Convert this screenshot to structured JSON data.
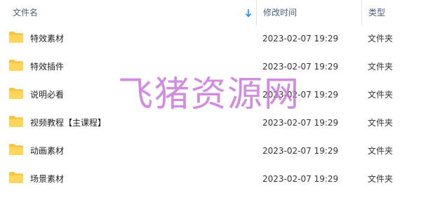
{
  "header": {
    "name_label": "文件名",
    "date_label": "修改时间",
    "type_label": "类型",
    "sort_icon": "sort-down-arrow-icon",
    "sort_color": "#1e90ff"
  },
  "folder_icon": {
    "name": "folder-icon",
    "color": "#ffd255"
  },
  "rows": [
    {
      "name": "特效素材",
      "date": "2023-02-07 19:29",
      "type": "文件夹"
    },
    {
      "name": "特效插件",
      "date": "2023-02-07 19:29",
      "type": "文件夹"
    },
    {
      "name": "说明必看",
      "date": "2023-02-07 19:29",
      "type": "文件夹"
    },
    {
      "name": "视频教程【主课程】",
      "date": "2023-02-07 19:29",
      "type": "文件夹"
    },
    {
      "name": "动画素材",
      "date": "2023-02-07 19:29",
      "type": "文件夹"
    },
    {
      "name": "场景素材",
      "date": "2023-02-07 19:29",
      "type": "文件夹"
    }
  ],
  "watermark": {
    "text": "飞猪资源网",
    "color": "#c46ad6"
  }
}
